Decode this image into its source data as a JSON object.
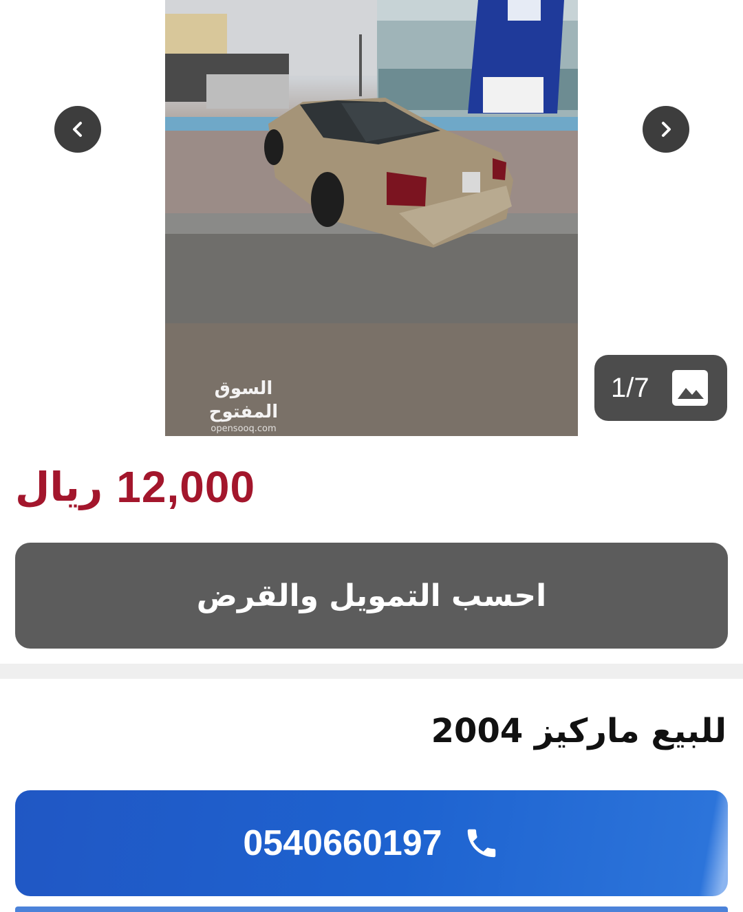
{
  "gallery": {
    "counter": "1/7",
    "watermark_ar": "السوق المفتوح",
    "watermark_en": "opensooq.com",
    "prev_icon": "chevron-left-icon",
    "next_icon": "chevron-right-icon",
    "counter_icon": "image-icon"
  },
  "price": {
    "amount": "12,000",
    "currency": "ريال",
    "color": "#a3162c"
  },
  "finance_button": {
    "label": "احسب التمويل والقرض"
  },
  "listing": {
    "title": "للبيع ماركيز 2004"
  },
  "call_button": {
    "phone": "0540660197",
    "icon": "phone-icon",
    "color": "#1e63d0"
  }
}
